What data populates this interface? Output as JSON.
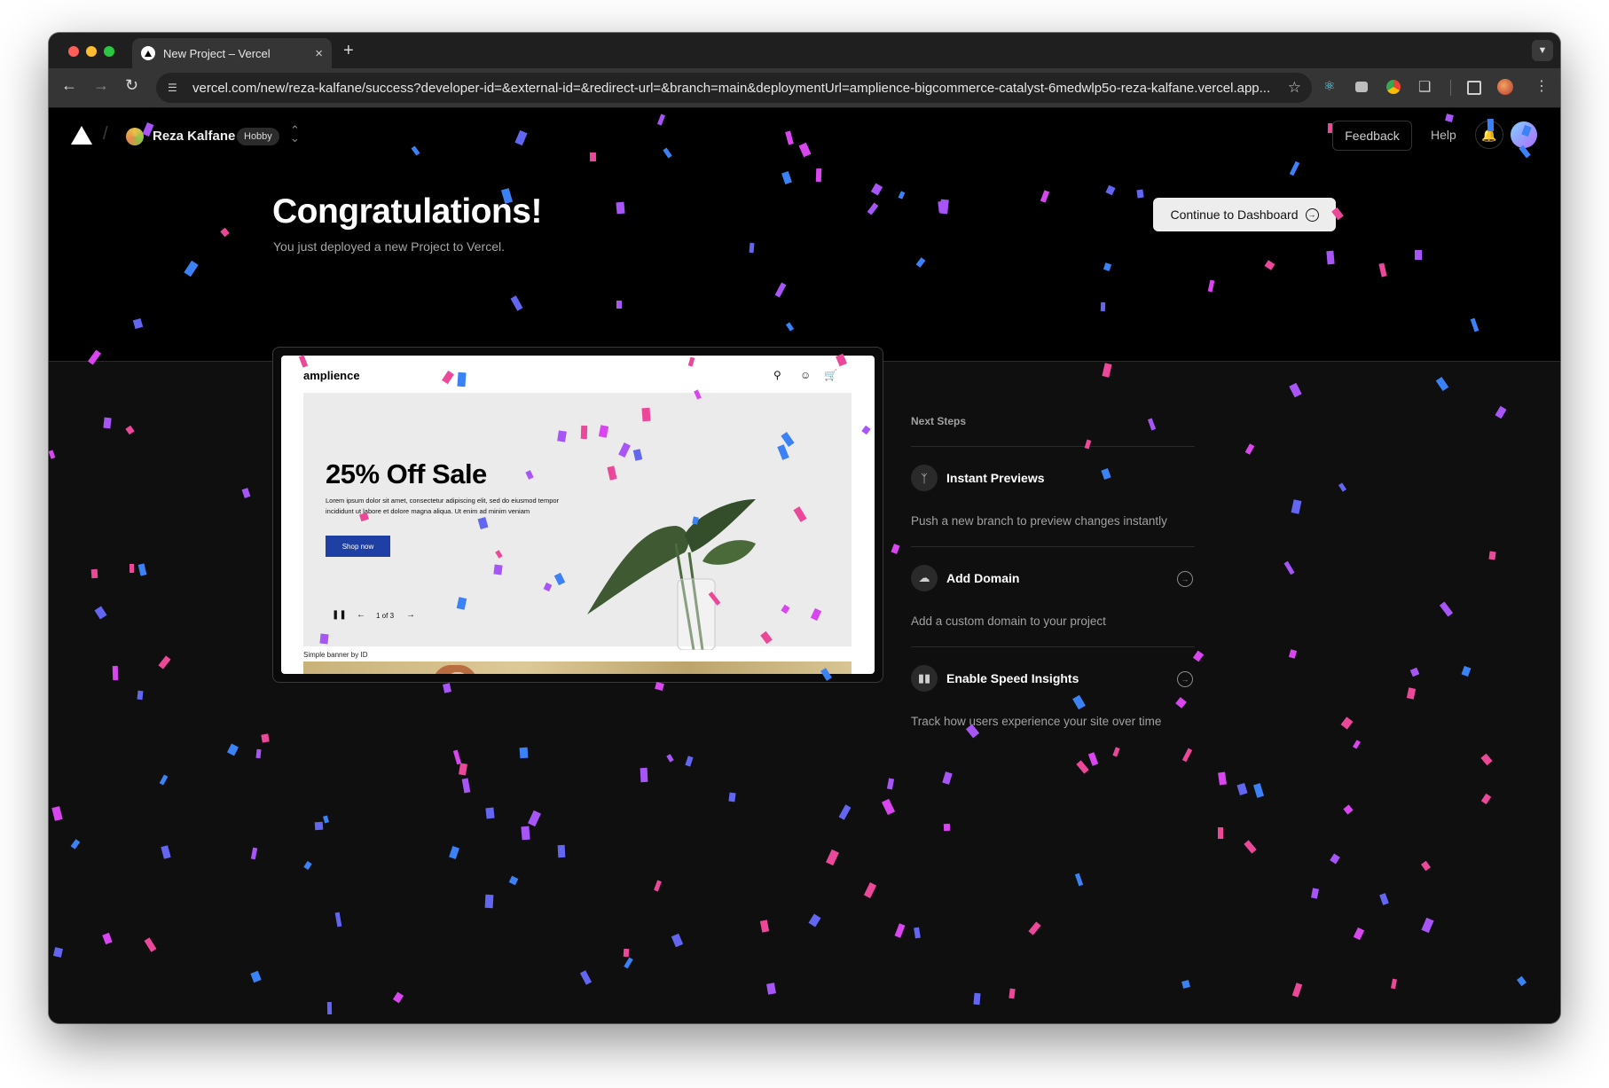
{
  "browser": {
    "tab_title": "New Project – Vercel",
    "tab_close": "×",
    "new_tab": "+",
    "url": "vercel.com/new/reza-kalfane/success?developer-id=&external-id=&redirect-url=&branch=main&deploymentUrl=amplience-bigcommerce-catalyst-6medwlp5o-reza-kalfane.vercel.app..."
  },
  "header": {
    "team_name": "Reza Kalfane",
    "plan_badge": "Hobby",
    "feedback_label": "Feedback",
    "help_label": "Help"
  },
  "hero": {
    "headline": "Congratulations!",
    "subline": "You just deployed a new Project to Vercel.",
    "continue_label": "Continue to Dashboard"
  },
  "preview": {
    "brand": "amplience",
    "sale_title": "25% Off Sale",
    "sale_body": "Lorem ipsum dolor sit amet, consectetur adipiscing elit, sed do eiusmod tempor incididunt ut labore et dolore magna aliqua. Ut enim ad minim veniam",
    "shop_label": "Shop now",
    "pager": "1 of 3",
    "banner_label": "Simple banner by ID"
  },
  "next_steps": {
    "title": "Next Steps",
    "items": [
      {
        "name": "Instant Previews",
        "desc": "Push a new branch to preview changes instantly",
        "icon": "git-branch-icon"
      },
      {
        "name": "Add Domain",
        "desc": "Add a custom domain to your project",
        "icon": "cloud-icon"
      },
      {
        "name": "Enable Speed Insights",
        "desc": "Track how users experience your site over time",
        "icon": "bar-chart-icon"
      }
    ]
  },
  "colors": {
    "confetti": [
      "#ec4899",
      "#a855f7",
      "#3b82f6",
      "#d946ef",
      "#6366f1"
    ]
  }
}
